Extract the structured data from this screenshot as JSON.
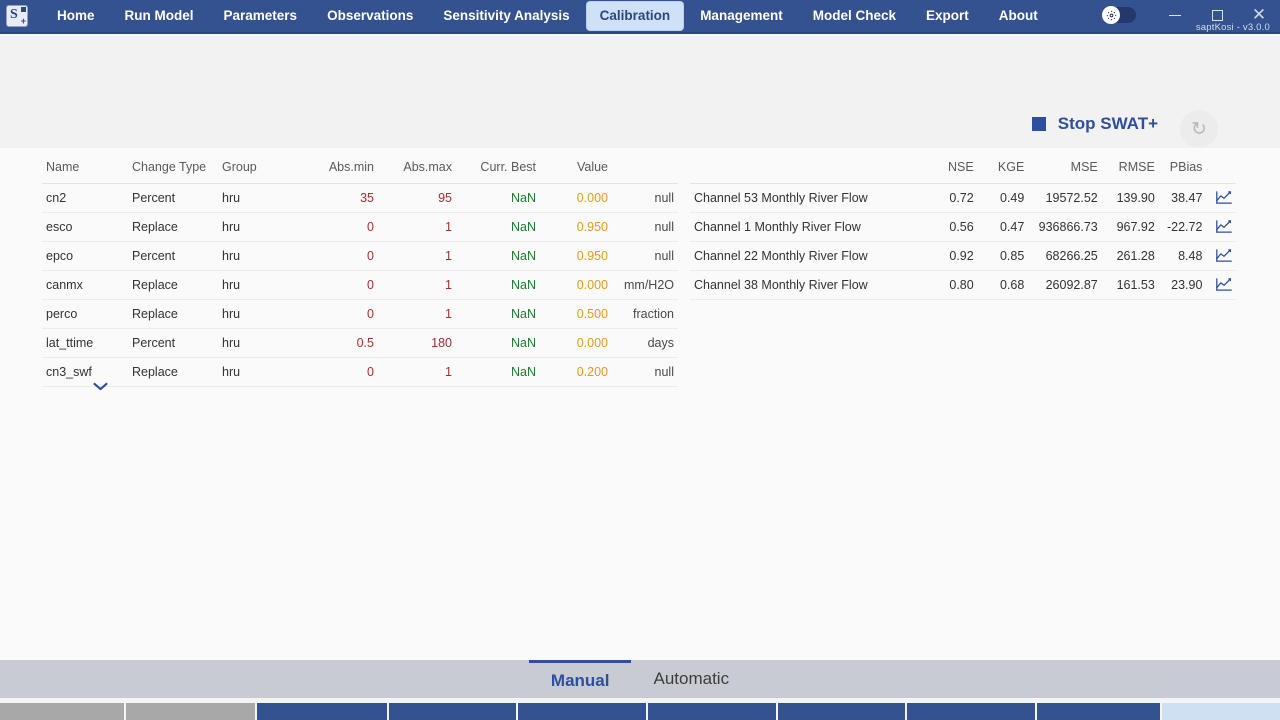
{
  "titlebar": {
    "logo_letter": "S",
    "logo_plus": "+",
    "menu": [
      {
        "label": "Home",
        "active": false
      },
      {
        "label": "Run Model",
        "active": false
      },
      {
        "label": "Parameters",
        "active": false
      },
      {
        "label": "Observations",
        "active": false
      },
      {
        "label": "Sensitivity Analysis",
        "active": false
      },
      {
        "label": "Calibration",
        "active": true
      },
      {
        "label": "Management",
        "active": false
      },
      {
        "label": "Model Check",
        "active": false
      },
      {
        "label": "Export",
        "active": false
      },
      {
        "label": "About",
        "active": false
      }
    ],
    "theme_toggle_icon": "gear-icon",
    "minimize_label": "–",
    "maximize_label": "□",
    "close_label": "✕",
    "version": "saptKosi  -  v3.0.0"
  },
  "toolbar": {
    "stop_label": "Stop SWAT+",
    "refresh_icon": "↻"
  },
  "parameters_table": {
    "headers": [
      "Name",
      "Change Type",
      "Group",
      "Abs.min",
      "Abs.max",
      "Curr. Best",
      "Value",
      ""
    ],
    "rows": [
      {
        "name": "cn2",
        "change_type": "Percent",
        "group": "hru",
        "abs_min": "35",
        "abs_max": "95",
        "curr_best": "NaN",
        "value": "0.000",
        "unit": "null"
      },
      {
        "name": "esco",
        "change_type": "Replace",
        "group": "hru",
        "abs_min": "0",
        "abs_max": "1",
        "curr_best": "NaN",
        "value": "0.950",
        "unit": "null"
      },
      {
        "name": "epco",
        "change_type": "Percent",
        "group": "hru",
        "abs_min": "0",
        "abs_max": "1",
        "curr_best": "NaN",
        "value": "0.950",
        "unit": "null"
      },
      {
        "name": "canmx",
        "change_type": "Replace",
        "group": "hru",
        "abs_min": "0",
        "abs_max": "1",
        "curr_best": "NaN",
        "value": "0.000",
        "unit": "mm/H2O"
      },
      {
        "name": "perco",
        "change_type": "Replace",
        "group": "hru",
        "abs_min": "0",
        "abs_max": "1",
        "curr_best": "NaN",
        "value": "0.500",
        "unit": "fraction"
      },
      {
        "name": "lat_ttime",
        "change_type": "Percent",
        "group": "hru",
        "abs_min": "0.5",
        "abs_max": "180",
        "curr_best": "NaN",
        "value": "0.000",
        "unit": "days"
      },
      {
        "name": "cn3_swf",
        "change_type": "Replace",
        "group": "hru",
        "abs_min": "0",
        "abs_max": "1",
        "curr_best": "NaN",
        "value": "0.200",
        "unit": "null"
      }
    ],
    "expand_icon": "⌄"
  },
  "results_table": {
    "headers": [
      "",
      "NSE",
      "KGE",
      "MSE",
      "RMSE",
      "PBias",
      ""
    ],
    "rows": [
      {
        "name": "Channel 53 Monthly River Flow",
        "nse": "0.72",
        "kge": "0.49",
        "mse": "19572.52",
        "rmse": "139.90",
        "pbias": "38.47",
        "chart_icon": "line-chart-icon"
      },
      {
        "name": "Channel 1 Monthly River Flow",
        "nse": "0.56",
        "kge": "0.47",
        "mse": "936866.73",
        "rmse": "967.92",
        "pbias": "-22.72",
        "chart_icon": "line-chart-icon"
      },
      {
        "name": "Channel 22 Monthly River Flow",
        "nse": "0.92",
        "kge": "0.85",
        "mse": "68266.25",
        "rmse": "261.28",
        "pbias": "8.48",
        "chart_icon": "line-chart-icon"
      },
      {
        "name": "Channel 38 Monthly River Flow",
        "nse": "0.80",
        "kge": "0.68",
        "mse": "26092.87",
        "rmse": "161.53",
        "pbias": "23.90",
        "chart_icon": "line-chart-icon"
      }
    ]
  },
  "bottom_tabs": [
    {
      "label": "Manual",
      "active": true
    },
    {
      "label": "Automatic",
      "active": false
    }
  ],
  "colors": {
    "brand_blue": "#34528f",
    "accent_blue": "#2d4f9e",
    "min_max_red": "#a03030",
    "best_green": "#1f7a33",
    "value_orange": "#e39a1c",
    "tabbar_gray": "#c8ccd2"
  }
}
